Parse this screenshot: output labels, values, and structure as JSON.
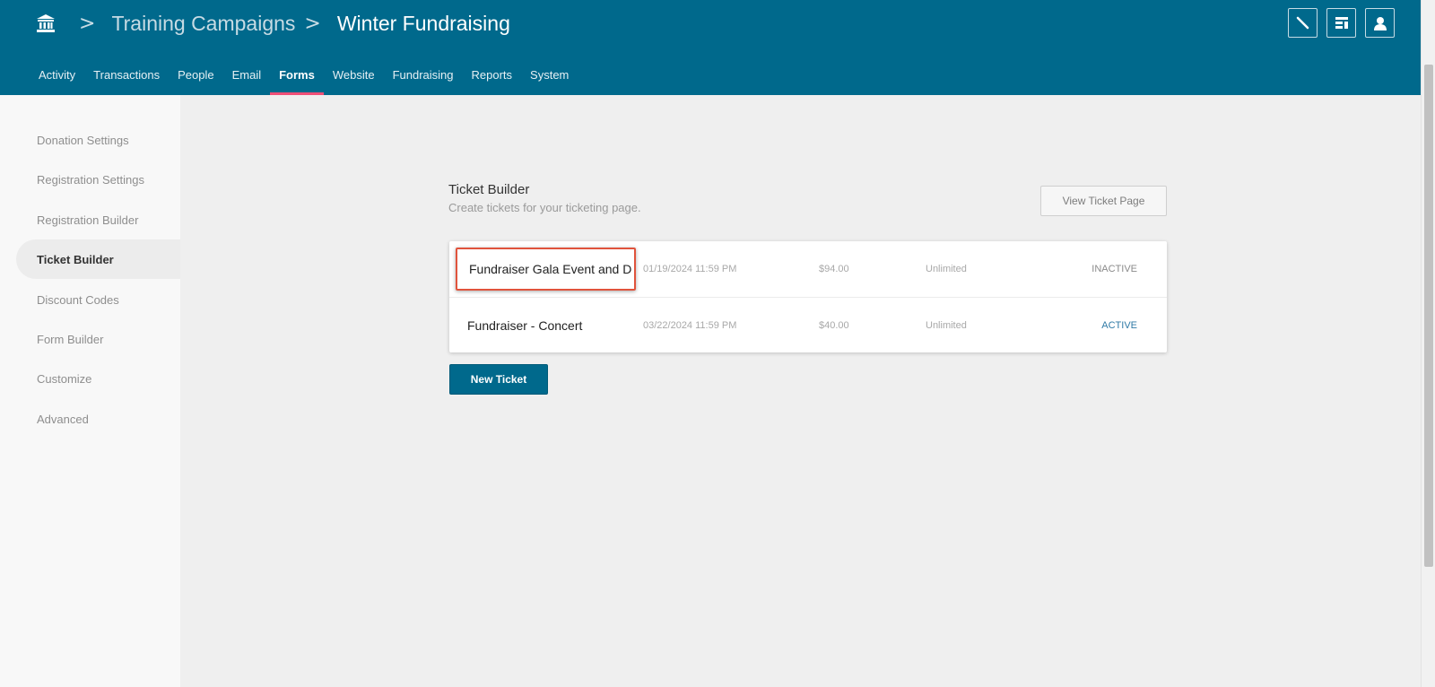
{
  "breadcrumb": {
    "home_icon": "institution-icon",
    "items": [
      "Training Campaigns",
      "Winter Fundraising"
    ],
    "separator": ">"
  },
  "top_actions": [
    "brush-icon",
    "layout-icon",
    "user-icon"
  ],
  "nav": {
    "items": [
      "Activity",
      "Transactions",
      "People",
      "Email",
      "Forms",
      "Website",
      "Fundraising",
      "Reports",
      "System"
    ],
    "active": "Forms"
  },
  "sidebar": {
    "items": [
      "Donation Settings",
      "Registration Settings",
      "Registration Builder",
      "Ticket Builder",
      "Discount Codes",
      "Form Builder",
      "Customize",
      "Advanced"
    ],
    "active": "Ticket Builder"
  },
  "main": {
    "title": "Ticket Builder",
    "subtitle": "Create tickets for your ticketing page.",
    "view_button": "View Ticket Page",
    "new_button": "New Ticket",
    "tickets": [
      {
        "name": "Fundraiser Gala Event and D",
        "date": "01/19/2024 11:59 PM",
        "price": "$94.00",
        "quantity": "Unlimited",
        "status": "INACTIVE"
      },
      {
        "name": "Fundraiser - Concert",
        "date": "03/22/2024 11:59 PM",
        "price": "$40.00",
        "quantity": "Unlimited",
        "status": "ACTIVE"
      }
    ]
  },
  "colors": {
    "header": "#00698c",
    "nav_active_underline": "#ef4f77",
    "highlight_border": "#e0533c",
    "active_status": "#2f7aa6"
  }
}
